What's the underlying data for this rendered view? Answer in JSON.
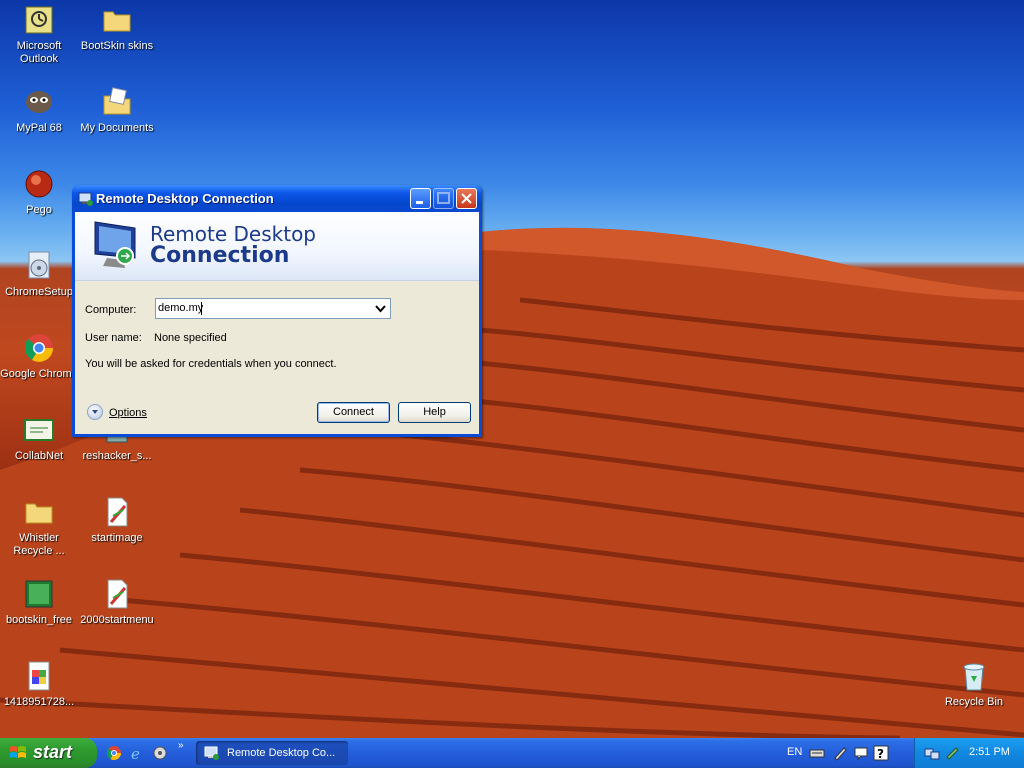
{
  "desktop": {
    "icons": [
      {
        "label": "Microsoft Outlook"
      },
      {
        "label": "BootSkin skins"
      },
      {
        "label": "MyPal 68"
      },
      {
        "label": "My Documents"
      },
      {
        "label": "Pego"
      },
      {
        "label": "ChromeSetup"
      },
      {
        "label": "Google Chrome"
      },
      {
        "label": "CollabNet"
      },
      {
        "label": "reshacker_s..."
      },
      {
        "label": "Whistler Recycle ..."
      },
      {
        "label": "startimage"
      },
      {
        "label": "bootskin_free"
      },
      {
        "label": "2000startmenu"
      },
      {
        "label": "1418951728..."
      },
      {
        "label": "Recycle Bin"
      }
    ]
  },
  "window": {
    "title": "Remote Desktop Connection",
    "banner_line1": "Remote Desktop",
    "banner_line2": "Connection",
    "computer_label": "Computer:",
    "computer_value": "demo.my",
    "username_label": "User name:",
    "username_value": "None specified",
    "note": "You will be asked for credentials when you connect.",
    "options_label": "Options",
    "connect_label": "Connect",
    "help_label": "Help"
  },
  "taskbar": {
    "start_label": "start",
    "task_label": "Remote Desktop Co...",
    "language": "EN",
    "clock": "2:51 PM"
  },
  "colors": {
    "title_blue": "#0447cc",
    "start_green": "#2f9a2f",
    "taskbar_blue": "#245edb"
  }
}
